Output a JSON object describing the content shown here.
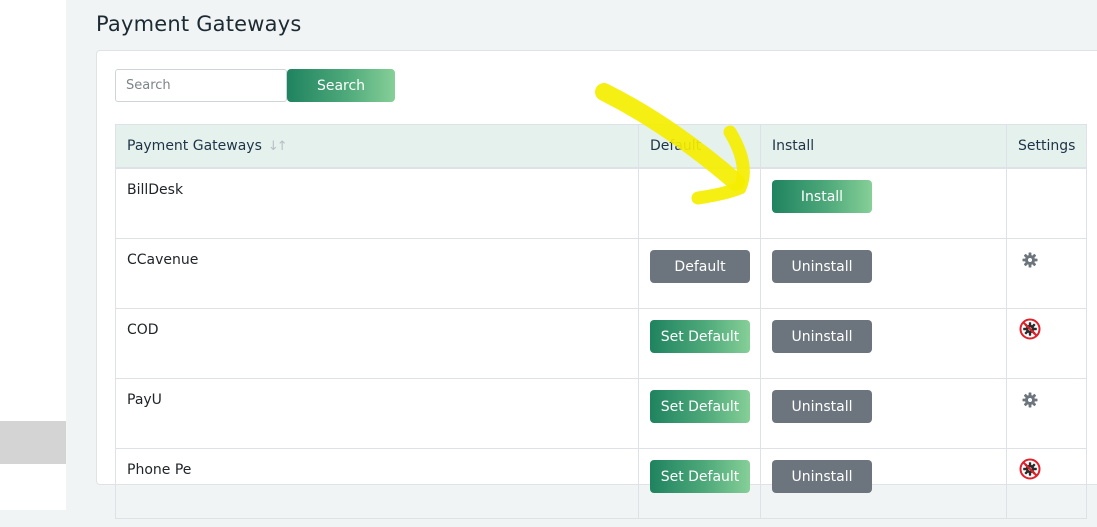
{
  "page": {
    "title": "Payment Gateways"
  },
  "search": {
    "placeholder": "Search",
    "value": "",
    "button_label": "Search"
  },
  "table": {
    "columns": [
      "Payment Gateways",
      "Default",
      "Install",
      "Settings"
    ],
    "rows": [
      {
        "name": "BillDesk",
        "default_label": null,
        "default_style": null,
        "install_label": "Install",
        "install_style": "green",
        "settings_icon": null
      },
      {
        "name": "CCavenue",
        "default_label": "Default",
        "default_style": "gray",
        "install_label": "Uninstall",
        "install_style": "gray",
        "settings_icon": "gear-icon"
      },
      {
        "name": "COD",
        "default_label": "Set Default",
        "default_style": "green",
        "install_label": "Uninstall",
        "install_style": "gray",
        "settings_icon": "settings-disabled-icon"
      },
      {
        "name": "PayU",
        "default_label": "Set Default",
        "default_style": "green",
        "install_label": "Uninstall",
        "install_style": "gray",
        "settings_icon": "gear-icon"
      },
      {
        "name": "Phone Pe",
        "default_label": "Set Default",
        "default_style": "green",
        "install_label": "Uninstall",
        "install_style": "gray",
        "settings_icon": "settings-disabled-icon"
      }
    ]
  },
  "colors": {
    "accent_green": "#1f8360",
    "gray_button": "#6c757d",
    "header_bg": "#e5f1ed",
    "annotation_yellow": "#f5ee00",
    "disabled_red": "#e0202a"
  }
}
